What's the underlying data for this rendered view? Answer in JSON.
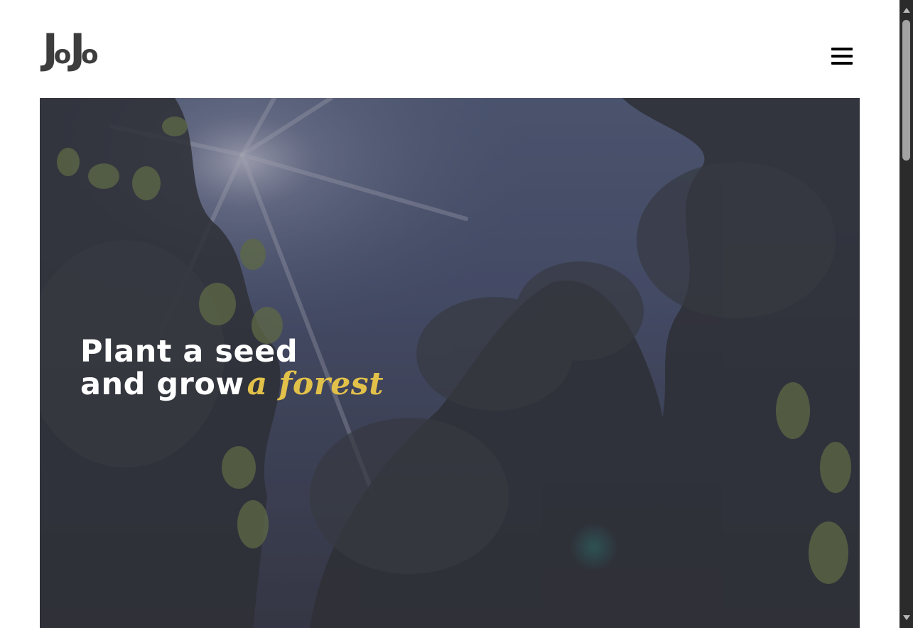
{
  "brand": {
    "logo_part1": "J",
    "logo_part2": "o",
    "logo_part3": "J",
    "logo_part4": "o"
  },
  "header": {
    "menu_icon": "hamburger-menu-icon"
  },
  "hero": {
    "headline_line1": "Plant a seed",
    "headline_line2": "and grow",
    "headline_accent": "a forest",
    "accent_color": "#e2c14a",
    "overlay_color": "#3a3d4c"
  },
  "colors": {
    "logo": "#3d3d3d",
    "menu_icon": "#000000",
    "headline": "#ffffff"
  }
}
